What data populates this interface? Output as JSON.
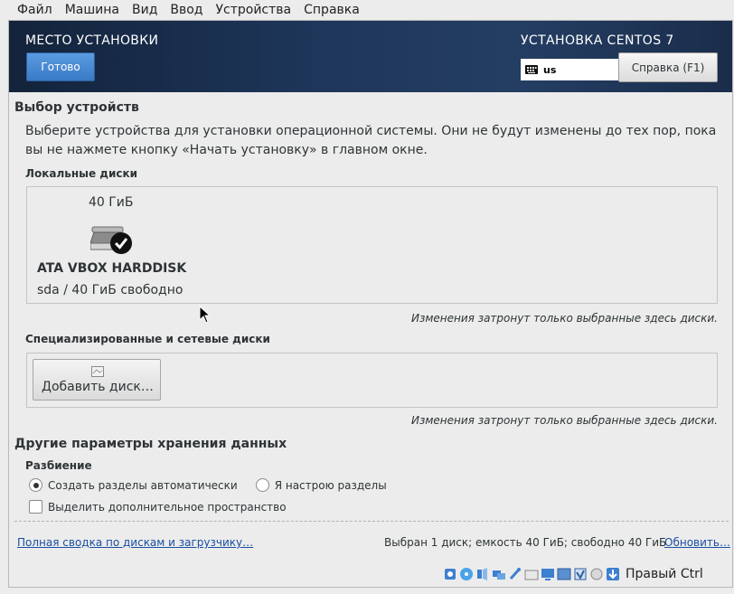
{
  "menubar": {
    "items": [
      "Файл",
      "Машина",
      "Вид",
      "Ввод",
      "Устройства",
      "Справка"
    ]
  },
  "header": {
    "title": "МЕСТО УСТАНОВКИ",
    "done_label": "Готово",
    "product": "УСТАНОВКА CENTOS 7",
    "keyboard_layout": "us",
    "help_label": "Справка (F1)"
  },
  "device_selection": {
    "title": "Выбор устройств",
    "description": "Выберите устройства для установки операционной системы. Они не будут изменены до тех пор, пока вы не нажмете кнопку «Начать установку» в главном окне.",
    "local_label": "Локальные диски",
    "disk": {
      "size": "40 ГиБ",
      "name": "ATA VBOX HARDDISK",
      "free": "sda  /  40 ГиБ свободно",
      "selected": true
    },
    "local_note": "Изменения затронут только выбранные здесь диски.",
    "network_label": "Специализированные и сетевые диски",
    "add_disk_label": "Добавить диск…",
    "network_note": "Изменения затронут только выбранные здесь диски."
  },
  "storage_options": {
    "title": "Другие параметры хранения данных",
    "partition_label": "Разбиение",
    "auto_label": "Создать разделы автоматически",
    "auto_selected": true,
    "manual_label": "Я настрою разделы",
    "manual_selected": false,
    "reclaim_label": "Выделить дополнительное пространство",
    "reclaim_checked": false
  },
  "footer": {
    "summary_link": "Полная сводка по дискам и загрузчику…",
    "summary": "Выбран 1 диск; емкость 40 ГиБ; свободно 40 ГиБ",
    "refresh_link": "Обновить…"
  },
  "vm_statusbar": {
    "host_key": "Правый Ctrl"
  },
  "colors": {
    "header_bg": "#1d3558",
    "done_button": "#4a8ad4",
    "link": "#1a4fa3"
  }
}
